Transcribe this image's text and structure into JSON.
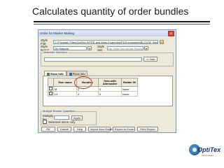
{
  "slide": {
    "title": "Calculates quantity of order bundles"
  },
  "dialog": {
    "title": "Order for Marker Making",
    "close_glyph": "x",
    "style_file": {
      "label": "Style File:",
      "value": "C:\\Program Files\\OptiTex 9\\PDS and Mark Examples\\PDS examples\\BLOUSE lining.PDS"
    },
    "style_name": {
      "label": "Style Name:",
      "value": "Ov-Hatsole"
    },
    "style_set": {
      "label": "Style Set:",
      "value": "No Style Set (all the Pieces)"
    },
    "materials": {
      "group_label": "Materials Selection",
      "add_label": "<< Add"
    },
    "tabs": [
      {
        "label": "Sizes Info",
        "active": true
      },
      {
        "label": "Piece Info",
        "active": false
      }
    ],
    "grid": {
      "columns": [
        "Size name",
        "Bundles",
        "Sets with Alternative",
        "Rotate 90"
      ],
      "rows": [
        {
          "size": "M",
          "bundles": "2",
          "sets": "0",
          "rotate": "None"
        },
        {
          "size": "L4",
          "bundles": "2",
          "sets": "0",
          "rotate": "None"
        }
      ]
    },
    "bundle": {
      "group_label": "Multiple Bundle Quantities",
      "multiply_label": "Multiply by:",
      "multiply_value": "",
      "apply_label": "Apply",
      "selected_only_label": "Selected sizes only"
    },
    "footer": {
      "ok": "OK",
      "cancel": "Cancel",
      "help": "Help",
      "import_excel": "Import from Excel",
      "export_excel": "Export to Excel",
      "print_report": "Print Report"
    }
  },
  "logo": {
    "wordmark": "OptiTex",
    "tagline": "Technologies"
  },
  "colors": {
    "accent": "#1b2f6e",
    "highlight": "#d23a2a",
    "dialog_bg": "#ece9d8"
  }
}
